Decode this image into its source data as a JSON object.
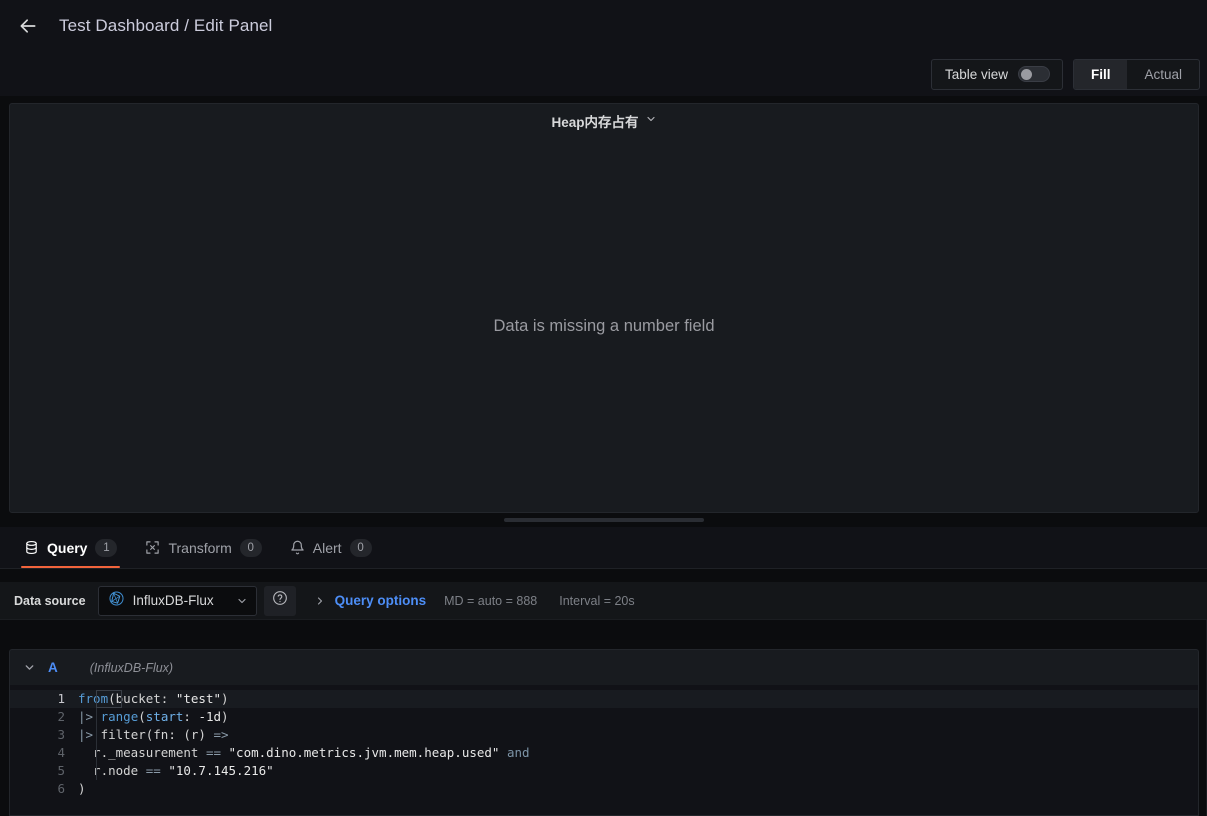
{
  "header": {
    "back_icon": "arrow-left-icon",
    "breadcrumb": "Test Dashboard / Edit Panel"
  },
  "toolbar": {
    "table_view_label": "Table view",
    "table_view_enabled": false,
    "size_segment": {
      "options": [
        "Fill",
        "Actual"
      ],
      "selected": "Fill"
    },
    "fill_label": "Fill",
    "actual_label": "Actual"
  },
  "panel": {
    "title": "Heap内存占有",
    "title_menu_icon": "chevron-down-icon",
    "message": "Data is missing a number field"
  },
  "drag_handle": {
    "name": "panel-resize-handle"
  },
  "tabs": [
    {
      "label": "Query",
      "badge": "1",
      "icon": "database-icon",
      "active": true
    },
    {
      "label": "Transform",
      "badge": "0",
      "icon": "process-icon",
      "active": false
    },
    {
      "label": "Alert",
      "badge": "0",
      "icon": "bell-icon",
      "active": false
    }
  ],
  "datasource_row": {
    "label": "Data source",
    "selected": "InfluxDB-Flux",
    "picker_icon": "influxdb-icon",
    "picker_chevron": "chevron-down-icon",
    "help_icon": "question-circle-icon",
    "query_options_label": "Query options",
    "query_options_chevron": "chevron-right-icon",
    "max_data_points": "MD = auto = 888",
    "interval": "Interval = 20s"
  },
  "query": {
    "collapse_icon": "chevron-down-icon",
    "ref_id": "A",
    "datasource_note": "(InfluxDB-Flux)",
    "code_lines": [
      {
        "n": "1",
        "text": "from(bucket: \"test\")"
      },
      {
        "n": "2",
        "text": "|> range(start: -1d)"
      },
      {
        "n": "3",
        "text": "|> filter(fn: (r) =>"
      },
      {
        "n": "4",
        "text": "  r._measurement == \"com.dino.metrics.jvm.mem.heap.used\" and"
      },
      {
        "n": "5",
        "text": "  r.node == \"10.7.145.216\""
      },
      {
        "n": "6",
        "text": ")"
      }
    ],
    "line_numbers": [
      "1",
      "2",
      "3",
      "4",
      "5",
      "6"
    ]
  },
  "colors": {
    "accent_orange": "#f2643c",
    "link_blue": "#4d8ef7",
    "app_bg": "#0b0c0e",
    "panel_bg": "#181b1f",
    "keyword_blue": "#569cd6"
  }
}
